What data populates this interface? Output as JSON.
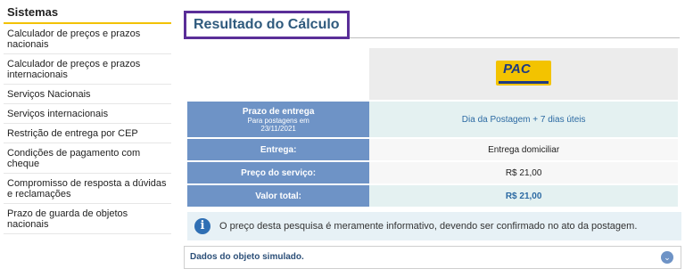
{
  "sidebar": {
    "title": "Sistemas",
    "items": [
      {
        "label": "Calculador de preços e prazos nacionais"
      },
      {
        "label": "Calculador de preços e prazos internacionais"
      },
      {
        "label": "Serviços Nacionais"
      },
      {
        "label": "Serviços internacionais"
      },
      {
        "label": "Restrição de entrega por CEP"
      },
      {
        "label": "Condições de pagamento com cheque"
      },
      {
        "label": "Compromisso de resposta a dúvidas e reclamações"
      },
      {
        "label": "Prazo de guarda de objetos nacionais"
      }
    ]
  },
  "main": {
    "title": "Resultado do Cálculo",
    "logo_text": "PAC",
    "rows": {
      "prazo_label": "Prazo de entrega",
      "prazo_sub1": "Para postagens em",
      "prazo_date": "23/11/2021",
      "prazo_value": "Dia da Postagem + 7 dias úteis",
      "entrega_label": "Entrega:",
      "entrega_value": "Entrega domiciliar",
      "preco_label": "Preço do serviço:",
      "preco_value": "R$ 21,00",
      "total_label": "Valor total:",
      "total_value": "R$ 21,00"
    },
    "info_text": "O preço desta pesquisa é meramente informativo, devendo ser confirmado no ato da postagem.",
    "accordion_label": "Dados do objeto simulado."
  }
}
